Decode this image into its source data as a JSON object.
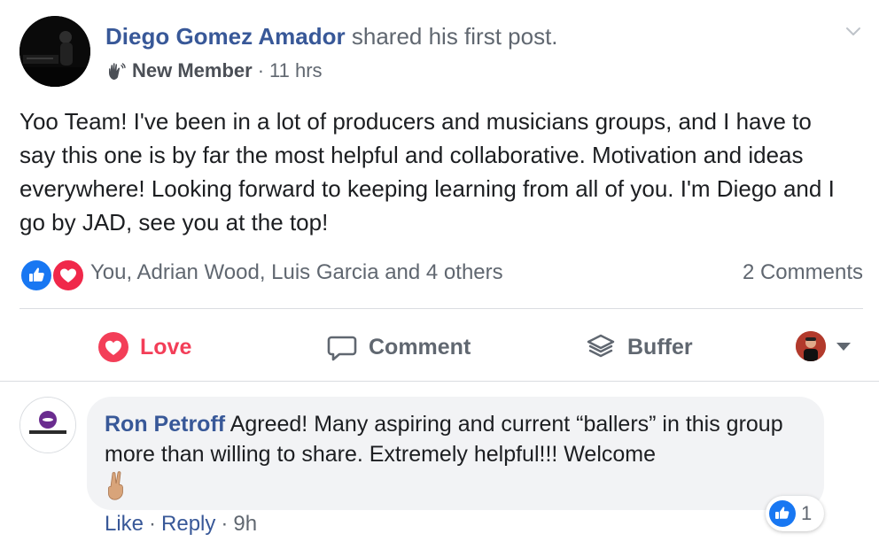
{
  "post": {
    "author_name": "Diego Gomez Amador",
    "author_action": "shared his first post.",
    "badge_label": "New Member",
    "time": "11 hrs",
    "body": "Yoo Team! I've been in a lot of producers and musicians groups, and I have to say this one is by far the most helpful and collaborative. Motivation and ideas everywhere! Looking forward to keeping learning from all of you. I'm Diego and I go by JAD, see you at the top!",
    "reactors": "You, Adrian Wood, Luis Garcia and 4 others",
    "comments_count": "2 Comments"
  },
  "actions": {
    "love_label": "Love",
    "comment_label": "Comment",
    "buffer_label": "Buffer"
  },
  "comment": {
    "author": "Ron Petroff",
    "text": "Agreed! Many aspiring and current “ballers” in this group more than willing to share. Extremely helpful!!! Welcome",
    "emoji": "victory-hand",
    "like_count": "1",
    "like_label": "Like",
    "reply_label": "Reply",
    "time": "9h"
  },
  "colors": {
    "link_blue": "#385898",
    "love_red": "#f33e58",
    "like_blue": "#1877f2",
    "meta_gray": "#606770",
    "bubble_bg": "#f2f3f5"
  },
  "icons": {
    "badge": "waving-hand-icon",
    "options": "chevron-down-icon",
    "reaction_like": "thumbs-up-icon",
    "reaction_love": "heart-icon",
    "action_love": "heart-icon",
    "action_comment": "speech-bubble-icon",
    "action_buffer": "buffer-layers-icon",
    "audience": "caret-down-icon"
  }
}
